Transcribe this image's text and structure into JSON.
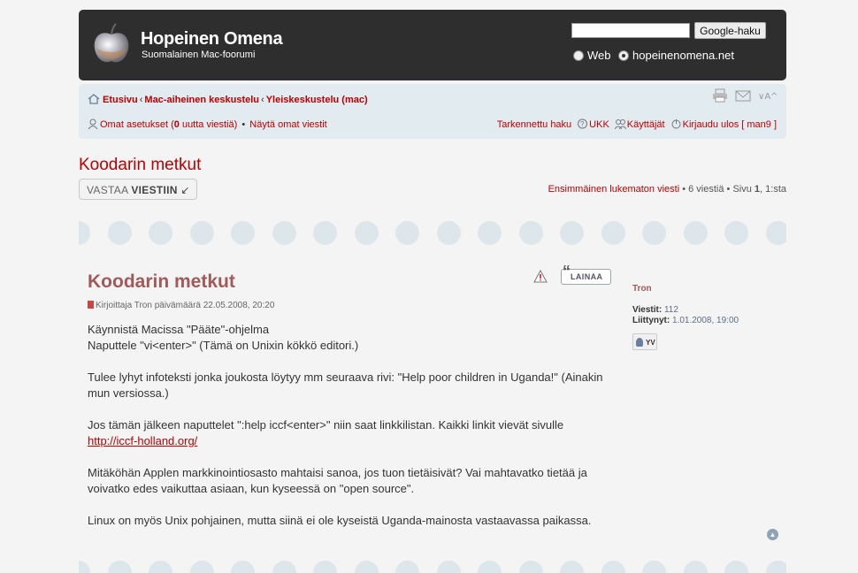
{
  "header": {
    "site_title": "Hopeinen Omena",
    "site_subtitle": "Suomalainen Mac-foorumi",
    "search_value": "",
    "search_button": "Google-haku",
    "radio_web": "Web",
    "radio_site": "hopeinenomena.net"
  },
  "breadcrumb": {
    "home": "Etusivu",
    "forum": "Mac-aiheinen keskustelu",
    "subforum": "Yleiskeskustelu (mac)"
  },
  "navbar": {
    "own_settings": "Omat asetukset (",
    "new_count": "0",
    "new_suffix": " uutta viestiä)",
    "show_own": "Näytä omat viestit",
    "advanced_search": "Tarkennettu haku",
    "faq": "UKK",
    "users": "Käyttäjät",
    "logout": "Kirjaudu ulos [ man9 ]"
  },
  "topic": {
    "title": "Koodarin metkut",
    "reply_prefix": "VASTAA ",
    "reply_bold": "VIESTIIN",
    "first_unread": "Ensimmäinen lukematon viesti",
    "pagination_rest": " • 6 viestiä • Sivu ",
    "page_current": "1",
    "page_total": ", 1:sta"
  },
  "post": {
    "title": "Koodarin metkut",
    "quote_label": "LAINAA",
    "meta_prefix": "Kirjoittaja ",
    "author": "Tron",
    "meta_date": " päivämäärä 22.05.2008, 20:20",
    "line1": "Käynnistä Macissa \"Pääte\"-ohjelma",
    "line2": "Naputtele \"vi<enter>\" (Tämä on Unixin kökkö editori.)",
    "para2": "Tulee lyhyt infoteksti jonka joukosta löytyy mm seuraava rivi: \"Help poor children in Uganda!\" (Ainakin mun versiossa.)",
    "para3": "Jos tämän jälkeen naputtelet \":help iccf<enter>\" niin saat linkkilistan. Kaikki linkit vievät sivulle",
    "link": "http://iccf-holland.org/",
    "para4": "Mitäköhän Applen markkinointiosasto mahtaisi sanoa, jos tuon tietäisivät? Vai mahtavatko tietää ja voivatko edes vaikuttaa asiaan, kun kyseessä on \"open source\".",
    "para5": "Linux on myös Unix pohjainen, mutta siinä ei ole kyseistä Uganda-mainosta vastaavassa paikassa."
  },
  "profile": {
    "name": "Tron",
    "posts_label": "Viestit:",
    "posts_value": "112",
    "joined_label": "Liittynyt:",
    "joined_value": "1.01.2008, 19:00",
    "pm_label": "YV"
  }
}
